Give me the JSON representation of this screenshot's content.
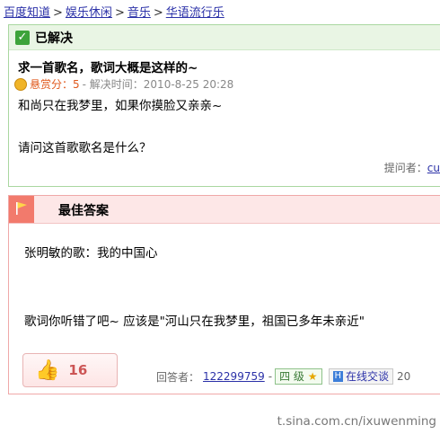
{
  "breadcrumb": {
    "items": [
      "百度知道",
      "娱乐休闲",
      "音乐",
      "华语流行乐"
    ],
    "separator": ">"
  },
  "question": {
    "status": "已解决",
    "title": "求一首歌名，歌词大概是这样的~",
    "bounty_label": "悬赏分：5",
    "resolved_label": "- 解决时间：2010-8-25 20:28",
    "line1": "和尚只在我梦里，如果你摸脸又亲亲~",
    "line2": "请问这首歌歌名是什么？",
    "asker_label": "提问者：",
    "asker_name": "cu"
  },
  "answer": {
    "header": "最佳答案",
    "line1": "张明敏的歌：我的中国心",
    "line2": "歌词你听错了吧~  应该是\"河山只在我梦里，祖国已多年未亲近\"",
    "like_count": "16",
    "answerer_label": "回答者：",
    "answerer_name": "122299759",
    "dash": "-",
    "level": "四  级",
    "chat_icon": "H",
    "chat_label": "在线交谈",
    "trailing": "20"
  },
  "watermark": "t.sina.com.cn/ixuwenming",
  "colors": {
    "link": "#2b31a8",
    "question_border": "#a9d7a0",
    "answer_border": "#f0a8a8",
    "bounty": "#e0591d"
  },
  "icons": [
    "check-icon",
    "coin-icon",
    "flag-icon",
    "thumbs-up-icon",
    "star-icon",
    "chat-icon"
  ]
}
